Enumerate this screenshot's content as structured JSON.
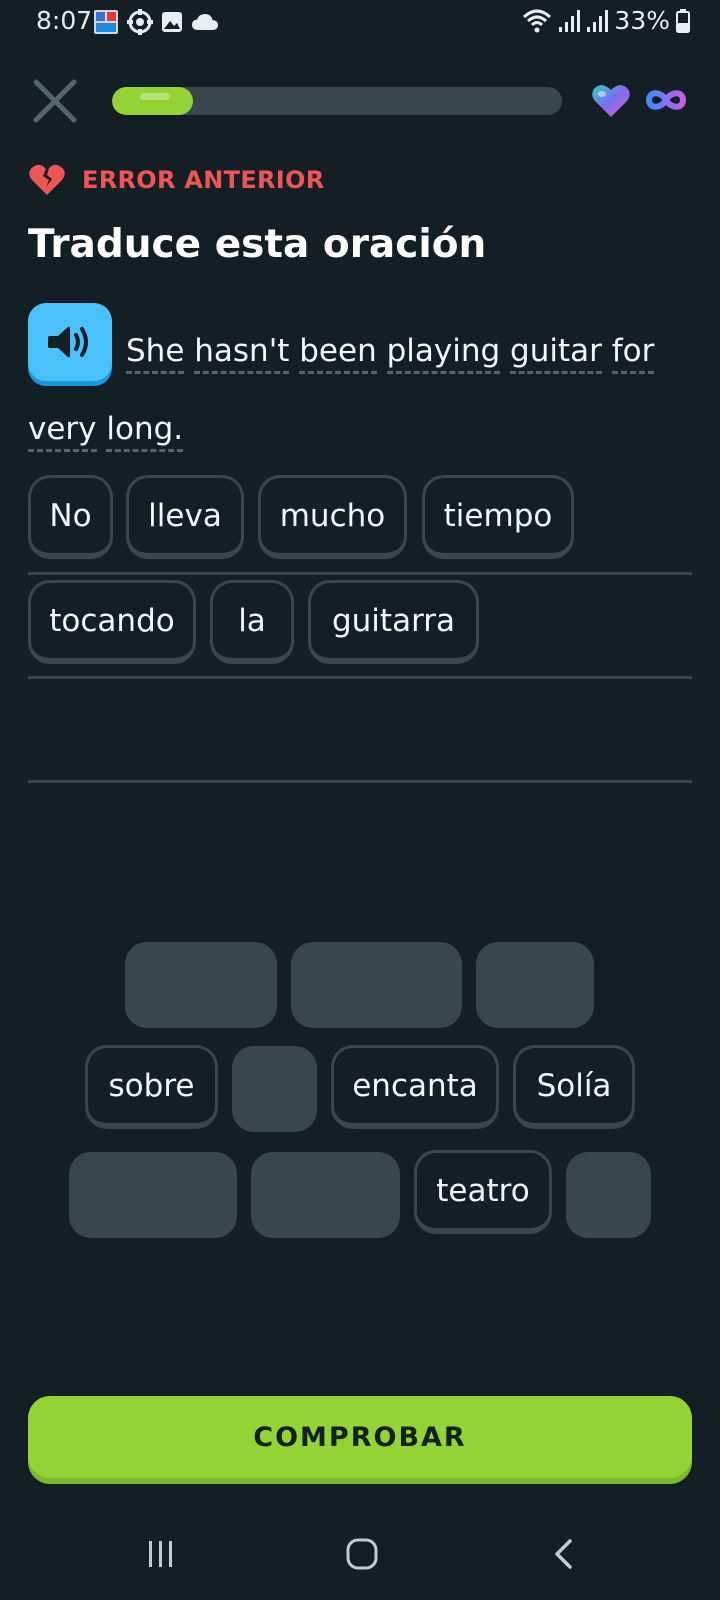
{
  "status_bar": {
    "time": "8:07",
    "battery_percent": "33%",
    "icons_left": [
      "notification-app-icon",
      "sync-icon",
      "gallery-icon",
      "cloud-icon"
    ],
    "icons_right": [
      "wifi-icon",
      "signal-icon",
      "signal-icon",
      "battery-icon"
    ]
  },
  "top_bar": {
    "progress_fraction": 0.18,
    "hearts": "unlimited"
  },
  "mistake_banner": {
    "label": "ERROR ANTERIOR"
  },
  "title": "Traduce esta oración",
  "prompt": {
    "words": [
      "She",
      "hasn't",
      "been",
      "playing",
      "guitar",
      "for",
      "very",
      "long."
    ]
  },
  "answer_tiles": [
    "No",
    "lleva",
    "mucho",
    "tiempo",
    "tocando",
    "la",
    "guitarra"
  ],
  "word_bank_tiles": [
    "sobre",
    "encanta",
    "Solía",
    "teatro"
  ],
  "check_button": {
    "label": "COMPROBAR"
  },
  "colors": {
    "background": "#131f24",
    "accent_green": "#93d333",
    "speaker_blue": "#49c0f8",
    "error_red": "#ee5555",
    "tile_border": "#37464f"
  }
}
